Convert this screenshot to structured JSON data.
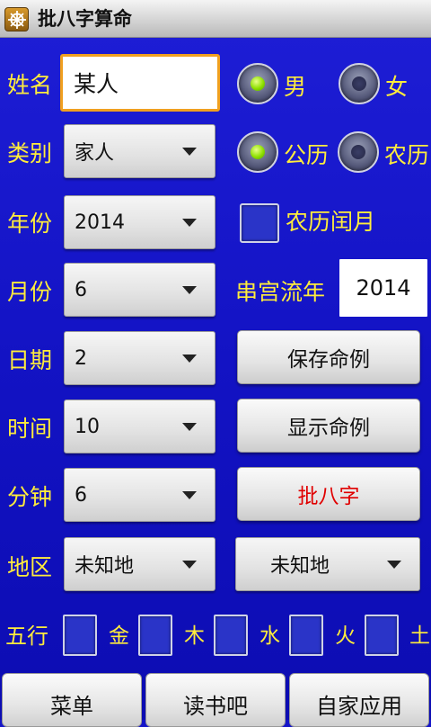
{
  "app": {
    "title": "批八字算命"
  },
  "labels": {
    "name": "姓名",
    "category": "类别",
    "year": "年份",
    "month": "月份",
    "day": "日期",
    "hour": "时间",
    "minute": "分钟",
    "region": "地区",
    "chuan_gong": "串宫流年",
    "wuxing": "五行"
  },
  "form": {
    "name_value": "某人",
    "category_value": "家人",
    "year_value": "2014",
    "month_value": "6",
    "day_value": "2",
    "hour_value": "10",
    "minute_value": "6",
    "region1_value": "未知地",
    "region2_value": "未知地",
    "chuan_gong_year": "2014"
  },
  "gender": {
    "male": "男",
    "female": "女",
    "selected": "male"
  },
  "calendar": {
    "solar": "公历",
    "lunar": "农历",
    "selected": "solar",
    "leap_month_label": "农历闰月",
    "leap_month_checked": false
  },
  "buttons": {
    "save": "保存命例",
    "show": "显示命例",
    "calc": "批八字"
  },
  "wuxing": [
    "金",
    "木",
    "水",
    "火",
    "土"
  ],
  "bottom": [
    "菜单",
    "读书吧",
    "自家应用"
  ],
  "colors": {
    "background": "#1414c8",
    "label": "#ffec3c",
    "focus_border": "#f0a020",
    "calc_text": "#e00000"
  }
}
